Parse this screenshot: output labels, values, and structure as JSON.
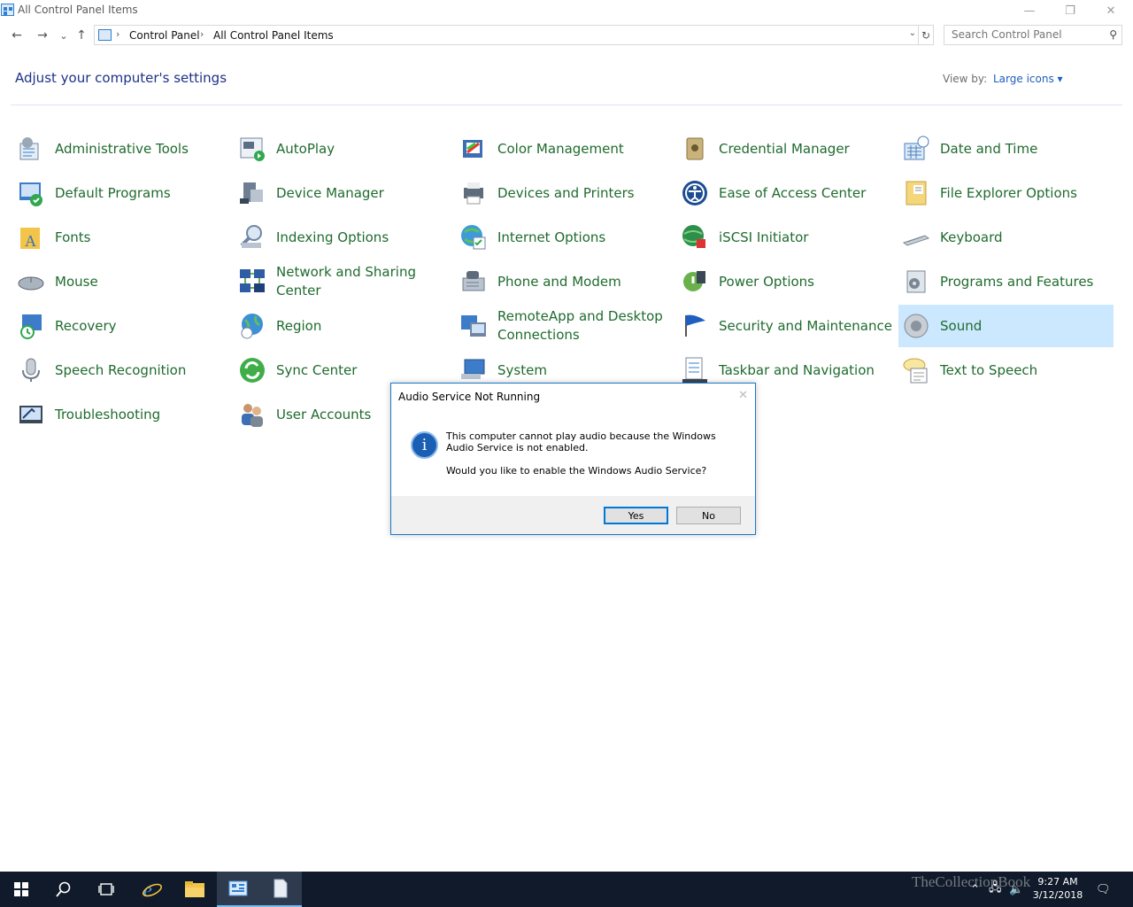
{
  "window": {
    "title": "All Control Panel Items",
    "controls": {
      "minimize": "—",
      "restore": "❐",
      "close": "✕"
    }
  },
  "nav": {
    "back": "←",
    "forward": "→",
    "recent": "⌄",
    "up": "↑",
    "breadcrumb": [
      "Control Panel",
      "All Control Panel Items"
    ],
    "search_placeholder": "Search Control Panel"
  },
  "header": {
    "title": "Adjust your computer's settings",
    "view_by_label": "View by:",
    "view_by_value": "Large icons"
  },
  "items": [
    [
      "Administrative Tools",
      "AutoPlay",
      "Color Management",
      "Credential Manager",
      "Date and Time"
    ],
    [
      "Default Programs",
      "Device Manager",
      "Devices and Printers",
      "Ease of Access Center",
      "File Explorer Options"
    ],
    [
      "Fonts",
      "Indexing Options",
      "Internet Options",
      "iSCSI Initiator",
      "Keyboard"
    ],
    [
      "Mouse",
      "Network and Sharing Center",
      "Phone and Modem",
      "Power Options",
      "Programs and Features"
    ],
    [
      "Recovery",
      "Region",
      "RemoteApp and Desktop Connections",
      "Security and Maintenance",
      "Sound"
    ],
    [
      "Speech Recognition",
      "Sync Center",
      "System",
      "Taskbar and Navigation",
      "Text to Speech"
    ],
    [
      "Troubleshooting",
      "User Accounts",
      "",
      "",
      ""
    ]
  ],
  "selected_item": "Sound",
  "dialog": {
    "title": "Audio Service Not Running",
    "message": "This computer cannot play audio because the Windows Audio Service is not enabled.",
    "question": "Would you like to enable the Windows Audio Service?",
    "yes_label": "Yes",
    "no_label": "No"
  },
  "taskbar": {
    "time": "9:27 AM",
    "date": "3/12/2018",
    "watermark": "TheCollectionBook"
  },
  "colors": {
    "link_green": "#1f6b2e",
    "heading_blue": "#1e3287",
    "selection": "#cce8ff",
    "taskbar": "#101a2a"
  }
}
